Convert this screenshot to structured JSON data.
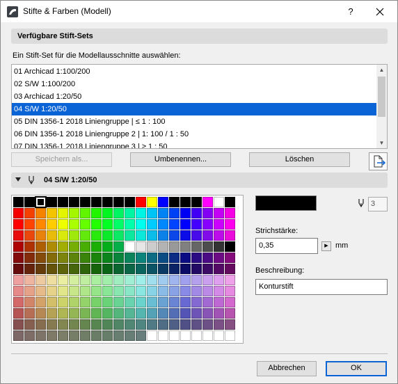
{
  "window": {
    "title": "Stifte & Farben (Modell)",
    "help_label": "?",
    "close_label": "close"
  },
  "pen_sets": {
    "section_title": "Verfügbare Stift-Sets",
    "instruction": "Ein Stift-Set für die Modellausschnitte auswählen:",
    "items": [
      "01 Archicad 1:100/200",
      "02 S/W 1:100/200",
      "03 Archicad 1:20/50",
      "04 S/W 1:20/50",
      "05 DIN 1356-1 2018 Liniengruppe | ≤ 1 : 100",
      "06 DIN 1356-1 2018 Liniengruppe 2 | 1: 100 / 1 : 50",
      "07 DIN 1356-1 2018 Liniengruppe 3 | ≥ 1 : 50"
    ],
    "selected_index": 3,
    "buttons": {
      "save_as": "Speichern als...",
      "rename": "Umbenennen...",
      "delete": "Löschen"
    }
  },
  "current_set": {
    "name": "04 S/W 1:20/50"
  },
  "pen": {
    "number": "3",
    "color": "#000000",
    "weight_label": "Strichstärke:",
    "weight_value": "0,35",
    "unit": "mm",
    "description_label": "Beschreibung:",
    "description_value": "Konturstift"
  },
  "palette": {
    "selected_pen": 3,
    "colors": []
  },
  "footer": {
    "cancel": "Abbrechen",
    "ok": "OK"
  }
}
